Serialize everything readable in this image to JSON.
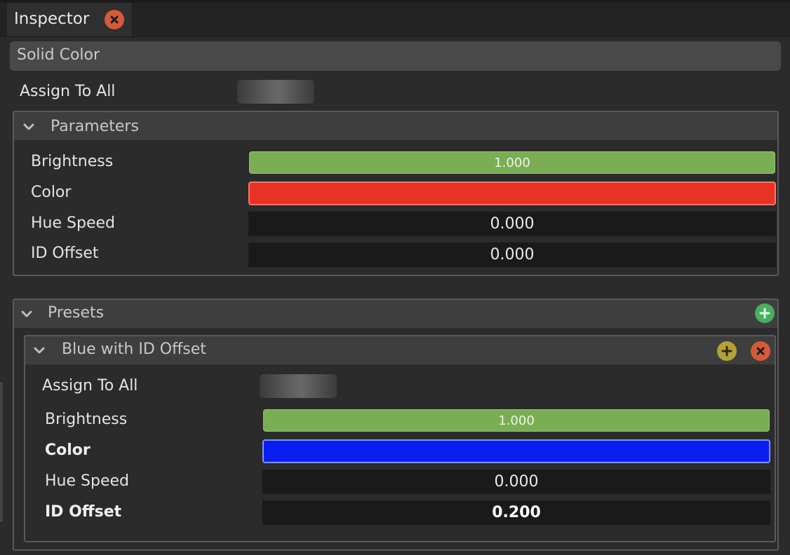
{
  "tab": {
    "title": "Inspector",
    "close_icon": "close-icon"
  },
  "component": {
    "title": "Solid Color"
  },
  "assign_to_all": {
    "label": "Assign To All"
  },
  "parameters": {
    "title": "Parameters",
    "brightness": {
      "label": "Brightness",
      "value": "1.000",
      "fraction": 1.0
    },
    "color": {
      "label": "Color",
      "hex": "#e83223"
    },
    "hue_speed": {
      "label": "Hue Speed",
      "value": "0.000"
    },
    "id_offset": {
      "label": "ID Offset",
      "value": "0.000"
    }
  },
  "presets": {
    "title": "Presets",
    "add_icon": "add-icon",
    "items": [
      {
        "title": "Blue with ID Offset",
        "assign_to_all": {
          "label": "Assign To All"
        },
        "brightness": {
          "label": "Brightness",
          "value": "1.000",
          "fraction": 1.0
        },
        "color": {
          "label": "Color",
          "hex": "#0a1ef0"
        },
        "hue_speed": {
          "label": "Hue Speed",
          "value": "0.000"
        },
        "id_offset": {
          "label": "ID Offset",
          "value": "0.200"
        }
      }
    ]
  },
  "colors": {
    "accent_green": "#7aae54",
    "close_red": "#d45a3a",
    "add_green": "#46b060",
    "add_yellow": "#b5a235"
  }
}
